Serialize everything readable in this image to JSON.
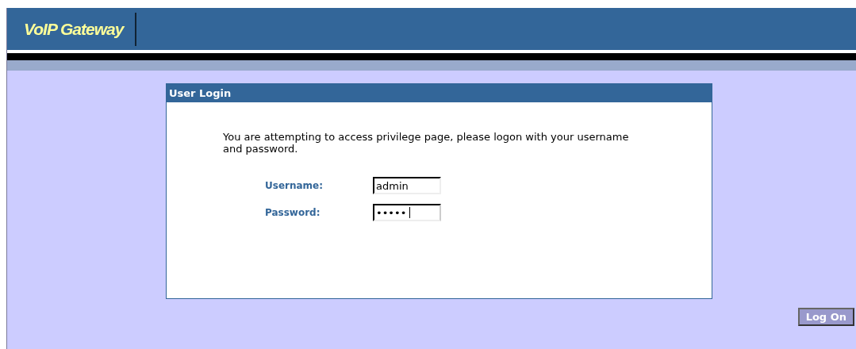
{
  "header": {
    "logo": "VoIP Gateway"
  },
  "login_panel": {
    "title": "User Login",
    "message": "You are attempting to access privilege page, please logon with your username and password.",
    "fields": [
      {
        "label": "Username:",
        "value": "admin",
        "focused": false
      },
      {
        "label": "Password:",
        "value": "•••••",
        "focused": true
      }
    ]
  },
  "submit_button": "Log On"
}
